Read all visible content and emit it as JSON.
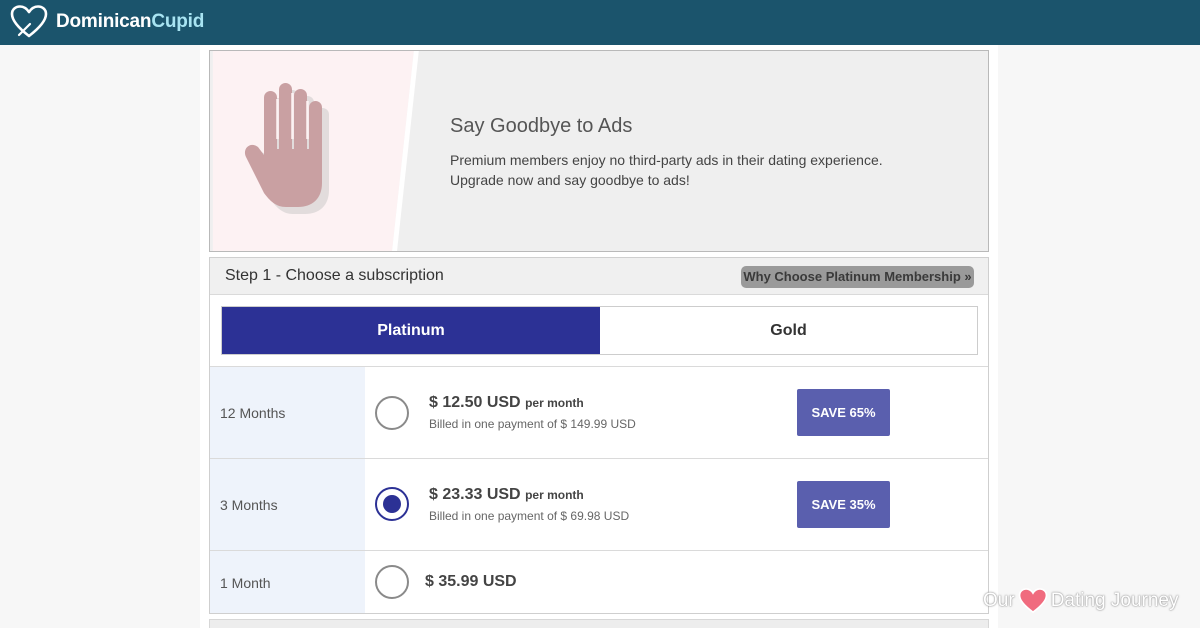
{
  "header": {
    "brand_part1": "Dominican",
    "brand_part2": "Cupid"
  },
  "banner": {
    "title": "Say Goodbye to Ads",
    "line1": "Premium members enjoy no third-party ads in their dating experience.",
    "line2": "Upgrade now and say goodbye to ads!"
  },
  "step": {
    "title": "Step 1 - Choose a subscription",
    "why_button": "Why Choose Platinum Membership »"
  },
  "tabs": [
    {
      "label": "Platinum",
      "active": true
    },
    {
      "label": "Gold",
      "active": false
    }
  ],
  "plans": [
    {
      "duration": "12 Months",
      "price": "$ 12.50 USD",
      "per": "per month",
      "billed": "Billed in one payment of $ 149.99 USD",
      "save": "SAVE 65%",
      "selected": false
    },
    {
      "duration": "3 Months",
      "price": "$ 23.33 USD",
      "per": "per month",
      "billed": "Billed in one payment of $ 69.98 USD",
      "save": "SAVE 35%",
      "selected": true
    },
    {
      "duration": "1 Month",
      "price": "$ 35.99 USD",
      "selected": false
    }
  ],
  "watermark": {
    "left": "Our",
    "right": "Dating Journey"
  },
  "colors": {
    "header": "#1b546c",
    "brand_accent": "#a8e4f2",
    "primary": "#2c3195",
    "save_button": "#5a5fae",
    "hand": "#c9a0a2"
  },
  "icons": {
    "brand_logo": "heart-outline-icon",
    "banner": "raised-hand-icon",
    "watermark": "heart-icon"
  }
}
